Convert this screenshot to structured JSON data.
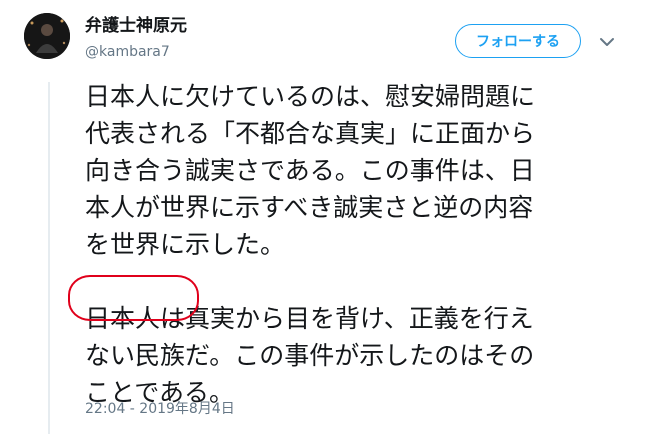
{
  "user": {
    "display_name": "弁護士神原元",
    "handle": "@kambara7"
  },
  "follow_button": {
    "label": "フォローする"
  },
  "tweet": {
    "paragraph1_lines": [
      "日本人に欠けているのは、慰安婦問題に",
      "代表される「不都合な真実」に正面から",
      "向き合う誠実さである。この事件は、日",
      "本人が世界に示すべき誠実さと逆の内容",
      "を世界に示した。"
    ],
    "paragraph2_highlight": "日本人は",
    "paragraph2_line1_rest": "真実から目を背け、正義を行え",
    "paragraph2_lines": [
      "ない民族だ。この事件が示したのはその",
      "ことである。"
    ],
    "timestamp": "22:04 - 2019年8月4日"
  },
  "colors": {
    "accent": "#1da1f2",
    "annotation_circle": "#e0001b",
    "secondary_text": "#657786"
  },
  "icons": {
    "caret": "chevron-down-icon"
  }
}
